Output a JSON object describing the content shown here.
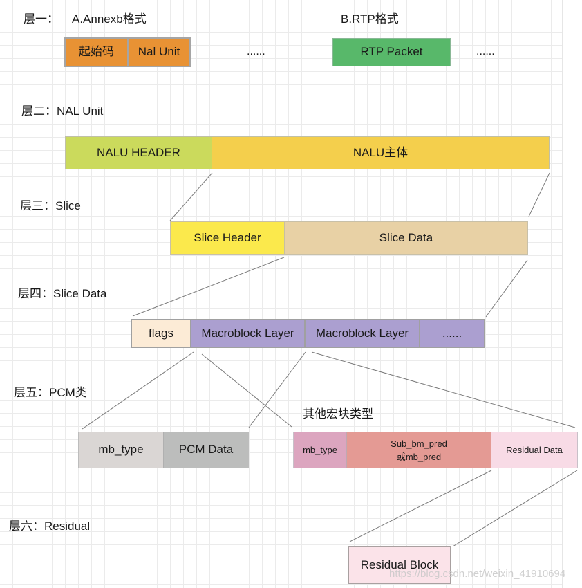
{
  "layer1": {
    "label": "层一：",
    "format_a": {
      "title": "A.Annexb格式",
      "cells": [
        "起始码",
        "Nal Unit"
      ],
      "ellipsis": "......",
      "color": "#e89234"
    },
    "format_b": {
      "title": "B.RTP格式",
      "cells": [
        "RTP Packet"
      ],
      "ellipsis": "......",
      "color": "#58b86a"
    }
  },
  "layer2": {
    "label": "层二：NAL Unit",
    "cells": [
      {
        "text": "NALU HEADER",
        "color": "#cbda5c"
      },
      {
        "text": "NALU主体",
        "color": "#f4cf4c"
      }
    ]
  },
  "layer3": {
    "label": "层三：Slice",
    "cells": [
      {
        "text": "Slice Header",
        "color": "#fbe94c"
      },
      {
        "text": "Slice Data",
        "color": "#e8d1a5"
      }
    ]
  },
  "layer4": {
    "label": "层四：Slice Data",
    "cells": [
      {
        "text": "flags",
        "color": "#fcebd6"
      },
      {
        "text": "Macroblock Layer",
        "color": "#ab9fd0"
      },
      {
        "text": "Macroblock Layer",
        "color": "#ab9fd0"
      },
      {
        "text": "......",
        "color": "#ab9fd0"
      }
    ]
  },
  "layer5": {
    "label": "层五：PCM类",
    "pcm_cells": [
      {
        "text": "mb_type",
        "color": "#dad6d4"
      },
      {
        "text": "PCM Data",
        "color": "#bcbdbc"
      }
    ],
    "other_title": "其他宏块类型",
    "other_cells": [
      {
        "text": "mb_type",
        "color": "#dca5bf"
      },
      {
        "text_line1": "Sub_bm_pred",
        "text_line2": "或mb_pred",
        "color": "#e49a94"
      },
      {
        "text": "Residual Data",
        "color": "#f8dbe6"
      }
    ]
  },
  "layer6": {
    "label": "层六：Residual",
    "cells": [
      {
        "text": "Residual Block",
        "color": "#fbe3e9"
      }
    ]
  },
  "watermark": "https://blog.csdn.net/weixin_41910694"
}
